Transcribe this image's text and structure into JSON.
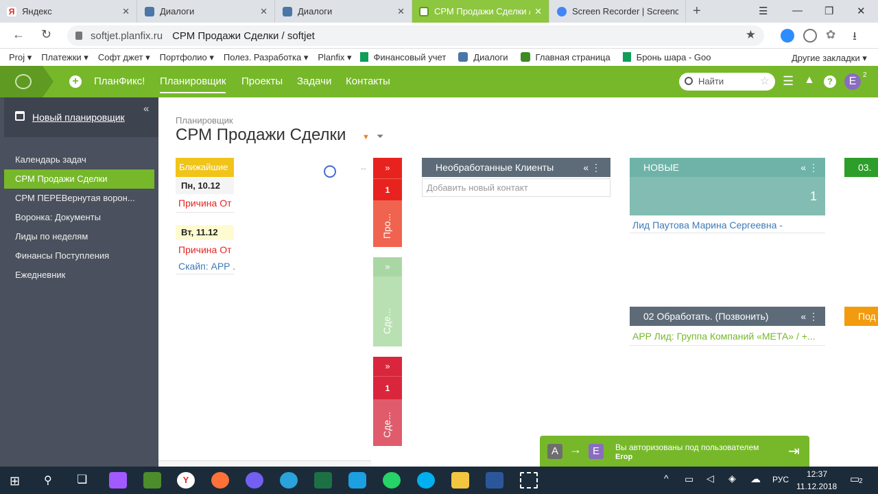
{
  "browser": {
    "tabs": [
      {
        "title": "Яндекс",
        "icon_color": "#e52620"
      },
      {
        "title": "Диалоги",
        "icon_color": "#4a76a8"
      },
      {
        "title": "Диалоги",
        "icon_color": "#4a76a8"
      },
      {
        "title": "СРМ Продажи Сделки /",
        "icon_color": "#ffffff"
      },
      {
        "title": "Screen Recorder | Screencas",
        "icon_color": "#4285f4"
      }
    ],
    "new_tab": "+",
    "url_domain": "softjet.planfix.ru",
    "url_title": "СРМ Продажи Сделки / softjet",
    "bookmarks": [
      "Proj ▾",
      "Платежки ▾",
      "Софт джет ▾",
      "Портфолио ▾",
      "Полез. Разработка ▾",
      "Planfix ▾",
      "Финансовый учет",
      "Диалоги",
      "Главная страница",
      "Бронь шара - Goo"
    ],
    "other_bookmarks": "Другие закладки ▾"
  },
  "app": {
    "nav": [
      "ПланФикс!",
      "Планировщик",
      "Проекты",
      "Задачи",
      "Контакты"
    ],
    "search_placeholder": "Найти",
    "user_initial": "Е",
    "user_badge": "2"
  },
  "sidebar": {
    "header": "Новый планировщик",
    "items": [
      "Календарь задач",
      "СРМ Продажи Сделки",
      "СРМ ПЕРЕВернутая ворон...",
      "Воронка: Документы",
      "Лиды по неделям",
      "Финансы Поступления",
      "Ежедневник"
    ]
  },
  "main": {
    "breadcrumb": "Планировщик",
    "title": "СРМ Продажи Сделки",
    "upcoming": {
      "header": "Ближайшие",
      "days": [
        {
          "date": "Пн, 10.12",
          "items": [
            "Причина От"
          ]
        },
        {
          "date": "Вт, 11.12",
          "items": [
            "Причина От",
            "Скайп: APP ."
          ]
        }
      ]
    },
    "vbars": [
      {
        "arrow": "»",
        "count": "1",
        "label": "Про..."
      },
      {
        "arrow": "»",
        "count": "",
        "label": "Сде..."
      },
      {
        "arrow": "»",
        "count": "1",
        "label": "Сде..."
      }
    ],
    "columns": {
      "unprocessed": {
        "title": "Необработанные Клиенты",
        "add_placeholder": "Добавить новый контакт"
      },
      "new": {
        "title": "НОВЫЕ",
        "count": "1",
        "item": "Лид Паутова Марина Сергеевна -"
      },
      "process": {
        "title": "02 Обработать. (Позвонить)",
        "item": "APP Лид: Группа Компаний «МЕТА» / +..."
      },
      "partial1": "03.",
      "partial2": "Под"
    },
    "col_icons": "« ⋮"
  },
  "toast": {
    "from": "А",
    "to": "Е",
    "line1": "Вы авторизованы под пользователем",
    "line2": "Егор"
  },
  "taskbar": {
    "lang": "РУС",
    "time": "12:37",
    "date": "11.12.2018",
    "notif_count": "2"
  },
  "colors": {
    "accent": "#76b82a",
    "sidebar": "#4a505d",
    "red": "#e8231f",
    "teal": "#6fb3a8",
    "slate": "#5d6b78"
  }
}
